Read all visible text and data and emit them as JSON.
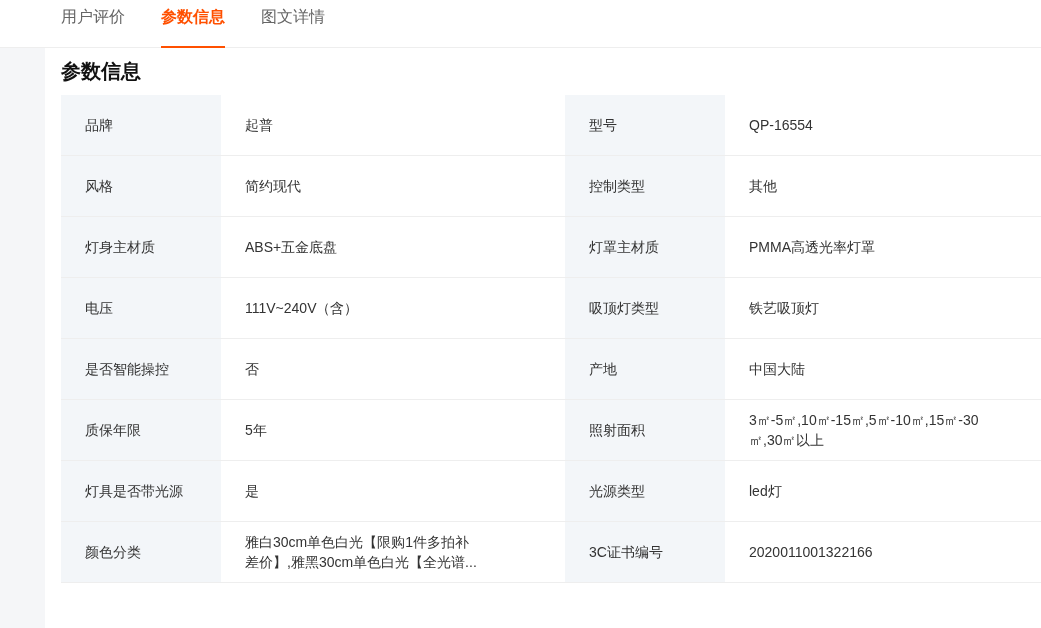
{
  "tabs": [
    {
      "label": "用户评价",
      "selected": false
    },
    {
      "label": "参数信息",
      "selected": true
    },
    {
      "label": "图文详情",
      "selected": false
    }
  ],
  "section_title": "参数信息",
  "params": [
    [
      {
        "label": "品牌",
        "value": "起普"
      },
      {
        "label": "型号",
        "value": "QP-16554"
      }
    ],
    [
      {
        "label": "风格",
        "value": "简约现代"
      },
      {
        "label": "控制类型",
        "value": "其他"
      }
    ],
    [
      {
        "label": "灯身主材质",
        "value": "ABS+五金底盘"
      },
      {
        "label": "灯罩主材质",
        "value": "PMMA高透光率灯罩"
      }
    ],
    [
      {
        "label": "电压",
        "value": "111V~240V（含）"
      },
      {
        "label": "吸顶灯类型",
        "value": "铁艺吸顶灯"
      }
    ],
    [
      {
        "label": "是否智能操控",
        "value": "否"
      },
      {
        "label": "产地",
        "value": "中国大陆"
      }
    ],
    [
      {
        "label": "质保年限",
        "value": "5年"
      },
      {
        "label": "照射面积",
        "value": "3㎡-5㎡,10㎡-15㎡,5㎡-10㎡,15㎡-30㎡,30㎡以上"
      }
    ],
    [
      {
        "label": "灯具是否带光源",
        "value": "是"
      },
      {
        "label": "光源类型",
        "value": "led灯"
      }
    ],
    [
      {
        "label": "颜色分类",
        "value": "雅白30cm单色白光【限购1件多拍补差价】,雅黑30cm单色白光【全光谱..."
      },
      {
        "label": "3C证书编号",
        "value": "2020011001322166"
      }
    ]
  ]
}
